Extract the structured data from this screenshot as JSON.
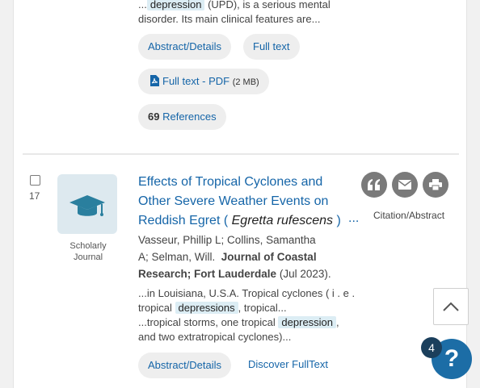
{
  "prev": {
    "snippet_pre": "...",
    "snippet_hl": "depression",
    "snippet_post": " (UPD), is a serious mental",
    "snippet_line2": "disorder. Its main clinical features are...",
    "abstract_label": "Abstract/Details",
    "fulltext_label": "Full text",
    "pdf_label": "Full text - PDF",
    "pdf_size": "(2 MB)",
    "ref_count": "69",
    "ref_label": "References"
  },
  "result": {
    "number": "17",
    "doc_type_line1": "Scholarly",
    "doc_type_line2": "Journal",
    "title_line1": "Effects of Tropical Cyclones and",
    "title_line2": "Other Severe Weather Events on",
    "title_line3_pre": "Reddish Egret (",
    "title_italic": "Egretta rufescens",
    "title_line3_post": ")",
    "title_ellipsis": "...",
    "authors_line1": "Vasseur, Phillip L; Collins, Samantha",
    "authors_line2_pre": "A; Selman, Will.",
    "journal_a": "Journal of Coastal",
    "journal_b": "Research; Fort Lauderdale",
    "date": "(Jul 2023).",
    "snip1_line1": "...in Louisiana, U.S.A. Tropical cyclones ( i . e .",
    "snip1_pre": "tropical",
    "snip1_hl": "depressions",
    "snip1_post": ", tropical...",
    "snip2_pre": "...tropical storms, one tropical",
    "snip2_hl": "depression",
    "snip2_post": ",",
    "snip2_line2": "and two extratropical cyclones)...",
    "abstract_label": "Abstract/Details",
    "discover_label": "Discover FullText",
    "cite_abstract_label": "Citation/Abstract"
  },
  "icons": {
    "cite": "quote-icon",
    "email": "email-icon",
    "print": "print-icon",
    "scroll": "chevron-up-icon",
    "help": "question-icon"
  },
  "help": {
    "badge": "4",
    "symbol": "?"
  },
  "colors": {
    "link": "#1565a8",
    "highlight": "#dcedf4",
    "help": "#1c6da6",
    "badge": "#1b3f5c"
  }
}
